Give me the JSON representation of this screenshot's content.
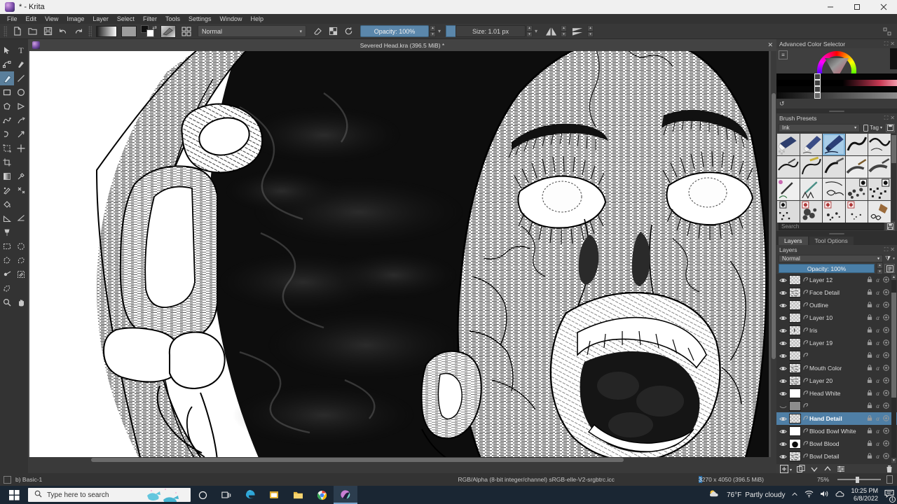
{
  "window": {
    "title": "* - Krita",
    "app_icon": "krita-logo-icon",
    "minimize_label": "—",
    "maximize_label": "❐",
    "close_label": "✕"
  },
  "menu": {
    "items": [
      "File",
      "Edit",
      "View",
      "Image",
      "Layer",
      "Select",
      "Filter",
      "Tools",
      "Settings",
      "Window",
      "Help"
    ]
  },
  "toolbar": {
    "new_label": "new-file-icon",
    "open_label": "open-folder-icon",
    "save_label": "save-disk-icon",
    "undo_label": "↺",
    "redo_label": "↻",
    "gradient_label": "gradient-swatch",
    "pattern_label": "pattern-swatch",
    "fg_bg_label": "foreground-background-colors",
    "brush_preview_label": "brush-preset-preview",
    "workspace_label": "workspace-chooser",
    "blend_mode": "Normal",
    "eraser_label": "eraser-icon",
    "alpha_lock_label": "preserve-alpha-icon",
    "reset_label": "reset-icon",
    "opacity_label": "Opacity:",
    "opacity_value": "100%",
    "size_label": "Size:",
    "size_value": "1.01 px",
    "mirror_h_label": "mirror-horizontal-icon",
    "mirror_v_label": "mirror-vertical-icon",
    "caret": "▾"
  },
  "toolbox": {
    "tools": [
      {
        "name": "select-shapes-tool",
        "glyph": "arrow"
      },
      {
        "name": "text-tool",
        "glyph": "T"
      },
      {
        "name": "edit-shapes-tool",
        "glyph": "node"
      },
      {
        "name": "calligraphy-tool",
        "glyph": "calligraphy"
      },
      {
        "name": "freehand-brush-tool",
        "glyph": "brush",
        "active": true
      },
      {
        "name": "line-tool",
        "glyph": "line"
      },
      {
        "name": "rectangle-tool",
        "glyph": "rect"
      },
      {
        "name": "ellipse-tool",
        "glyph": "ellipse"
      },
      {
        "name": "polygon-tool",
        "glyph": "polygon"
      },
      {
        "name": "polyline-tool",
        "glyph": "polyline"
      },
      {
        "name": "bezier-curve-tool",
        "glyph": "bezier"
      },
      {
        "name": "freehand-path-tool",
        "glyph": "freehandpath"
      },
      {
        "name": "dynamic-brush-tool",
        "glyph": "dynbrush"
      },
      {
        "name": "multibrush-tool",
        "glyph": "multibrush"
      },
      {
        "name": "transform-tool",
        "glyph": "transform"
      },
      {
        "name": "move-tool",
        "glyph": "move"
      },
      {
        "name": "crop-tool",
        "glyph": "crop"
      },
      {
        "name": "gradient-tool",
        "glyph": "gradient"
      },
      {
        "name": "color-picker-tool",
        "glyph": "dropper"
      },
      {
        "name": "colorize-mask-tool",
        "glyph": "colorize"
      },
      {
        "name": "smart-patch-tool",
        "glyph": "patch"
      },
      {
        "name": "fill-tool",
        "glyph": "fill"
      },
      {
        "name": "gradient-edit-tool",
        "glyph": "gradedit"
      },
      {
        "name": "measure-tool",
        "glyph": "measure"
      },
      {
        "name": "reference-images-tool",
        "glyph": "pin"
      },
      {
        "name": "rectangular-selection-tool",
        "glyph": "rectsel"
      },
      {
        "name": "elliptical-selection-tool",
        "glyph": "ellsel"
      },
      {
        "name": "polygonal-selection-tool",
        "glyph": "polysel"
      },
      {
        "name": "freehand-selection-tool",
        "glyph": "lassosel"
      },
      {
        "name": "contiguous-selection-tool",
        "glyph": "magicwand"
      },
      {
        "name": "similar-color-selection-tool",
        "glyph": "simsel"
      },
      {
        "name": "bezier-selection-tool",
        "glyph": "beziersel"
      },
      {
        "name": "zoom-tool",
        "glyph": "zoom"
      },
      {
        "name": "pan-tool",
        "glyph": "hand"
      }
    ]
  },
  "document": {
    "tab_title": "Severed Head.kra (396.5 MiB) *",
    "close_label": "✕",
    "artwork_description": "screaming face ink hatching with hand holding bowl"
  },
  "color_selector": {
    "title": "Advanced Color Selector",
    "menu_icon": "hamburger-icon",
    "reset_icon": "reset-icon",
    "float_icon": "float-panel-icon",
    "close_icon": "close-panel-icon"
  },
  "brush_presets": {
    "title": "Brush Presets",
    "tag_filter": "Ink",
    "tag_label": "Tag",
    "tag_caret": "▾",
    "search_placeholder": "Search",
    "save_icon": "save-icon",
    "storage_icon": "resource-storage-icon",
    "selected_index": 2,
    "columns": 5,
    "rows": 4
  },
  "docker_tabs": {
    "items": [
      {
        "label": "Layers",
        "active": true
      },
      {
        "label": "Tool Options",
        "active": false
      }
    ]
  },
  "layers_panel": {
    "title": "Layers",
    "blend_mode": "Normal",
    "blend_caret": "▾",
    "filter_icon": "filter-funnel-icon",
    "filter_caret": "▾",
    "opacity_label": "Opacity:",
    "opacity_value": "100%",
    "properties_icon": "layer-properties-icon",
    "alpha_glyph": "α",
    "lock_glyph": "lock-icon",
    "style_glyph": "layer-style-icon",
    "rows": [
      {
        "name": "Layer 12",
        "visible": true,
        "selected": false,
        "thumb": "transparent"
      },
      {
        "name": "Face Detail",
        "visible": true,
        "selected": false,
        "thumb": "sparse-ink"
      },
      {
        "name": "Outline",
        "visible": true,
        "selected": false,
        "thumb": "transparent"
      },
      {
        "name": "Layer 10",
        "visible": true,
        "selected": false,
        "thumb": "transparent"
      },
      {
        "name": "Iris",
        "visible": true,
        "selected": false,
        "thumb": "tiny-mark"
      },
      {
        "name": "Layer 19",
        "visible": true,
        "selected": false,
        "thumb": "transparent"
      },
      {
        "name": "",
        "visible": true,
        "selected": false,
        "thumb": "transparent"
      },
      {
        "name": "Mouth Color",
        "visible": true,
        "selected": false,
        "thumb": "sparse-ink"
      },
      {
        "name": "Layer 20",
        "visible": true,
        "selected": false,
        "thumb": "sparse-ink"
      },
      {
        "name": "Head White",
        "visible": true,
        "selected": false,
        "thumb": "white"
      },
      {
        "name": "",
        "visible": false,
        "selected": false,
        "thumb": "grey"
      },
      {
        "name": "Hand Detail",
        "visible": true,
        "selected": true,
        "thumb": "transparent"
      },
      {
        "name": "Blood Bowl White",
        "visible": true,
        "selected": false,
        "thumb": "white"
      },
      {
        "name": "Bowl Blood",
        "visible": true,
        "selected": false,
        "thumb": "black-blob"
      },
      {
        "name": "Bowl Detail",
        "visible": true,
        "selected": false,
        "thumb": "sparse-ink"
      },
      {
        "name": "",
        "visible": false,
        "selected": false,
        "thumb": "grey"
      }
    ],
    "footer": {
      "add_layer": "add-layer-icon",
      "add_caret": "▾",
      "duplicate": "duplicate-layer-icon",
      "move_down": "move-layer-down-icon",
      "move_up": "move-layer-up-icon",
      "properties": "layer-properties-icon",
      "delete": "delete-layer-icon"
    }
  },
  "statusbar": {
    "selection_icon": "selection-mode-icon",
    "brush_preset": "b) Basic-1",
    "color_profile": "RGB/Alpha (8-bit integer/channel)  sRGB-elle-V2-srgbtrc.icc",
    "image_size_hl": "3",
    "image_size": "270 x 4050 (396.5 MiB)",
    "zoom": "75%",
    "fit_icon": "fit-page-icon"
  },
  "taskbar": {
    "start_label": "windows-start-icon",
    "search_placeholder": "Type here to search",
    "search_icon": "magnifier-icon",
    "items": [
      {
        "name": "cortana-icon",
        "glyph": "◯",
        "active": false
      },
      {
        "name": "task-view-icon",
        "glyph": "❏",
        "active": false
      },
      {
        "name": "edge-icon",
        "glyph": "e",
        "active": false
      },
      {
        "name": "store-icon",
        "glyph": "▤",
        "active": false
      },
      {
        "name": "file-explorer-icon",
        "glyph": "▥",
        "active": false
      },
      {
        "name": "chrome-icon",
        "glyph": "◉",
        "active": false
      },
      {
        "name": "krita-taskbar-icon",
        "glyph": "◒",
        "active": true
      }
    ],
    "weather_temp": "76°F",
    "weather_desc": "Partly cloudy",
    "chevron": "︿",
    "wifi_icon": "wifi-icon",
    "volume_icon": "volume-icon",
    "onedrive_icon": "onedrive-icon",
    "time": "10:25 PM",
    "date": "6/8/2022",
    "notification_icon": "notifications-icon",
    "notification_count": "1"
  }
}
